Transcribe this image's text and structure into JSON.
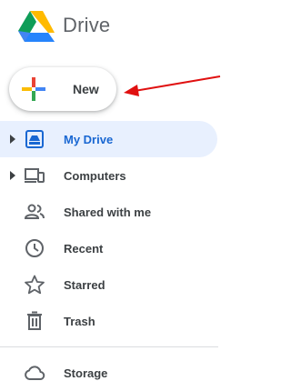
{
  "app": {
    "title": "Drive",
    "logo_icon": "google-drive-logo"
  },
  "new_button": {
    "label": "New",
    "icon": "plus-icon"
  },
  "nav": {
    "items": [
      {
        "label": "My Drive",
        "icon": "my-drive-icon",
        "expandable": true,
        "active": true
      },
      {
        "label": "Computers",
        "icon": "computers-icon",
        "expandable": true,
        "active": false
      },
      {
        "label": "Shared with me",
        "icon": "people-icon",
        "expandable": false,
        "active": false
      },
      {
        "label": "Recent",
        "icon": "clock-icon",
        "expandable": false,
        "active": false
      },
      {
        "label": "Starred",
        "icon": "star-icon",
        "expandable": false,
        "active": false
      },
      {
        "label": "Trash",
        "icon": "trash-icon",
        "expandable": false,
        "active": false
      }
    ]
  },
  "storage": {
    "label": "Storage",
    "icon": "cloud-icon"
  },
  "annotation": {
    "icon": "red-arrow",
    "color": "#e01010"
  },
  "colors": {
    "active_bg": "#e8f0fe",
    "active_text": "#1967d2",
    "text": "#3c4043",
    "icon": "#5f6368",
    "divider": "#dadce0"
  }
}
